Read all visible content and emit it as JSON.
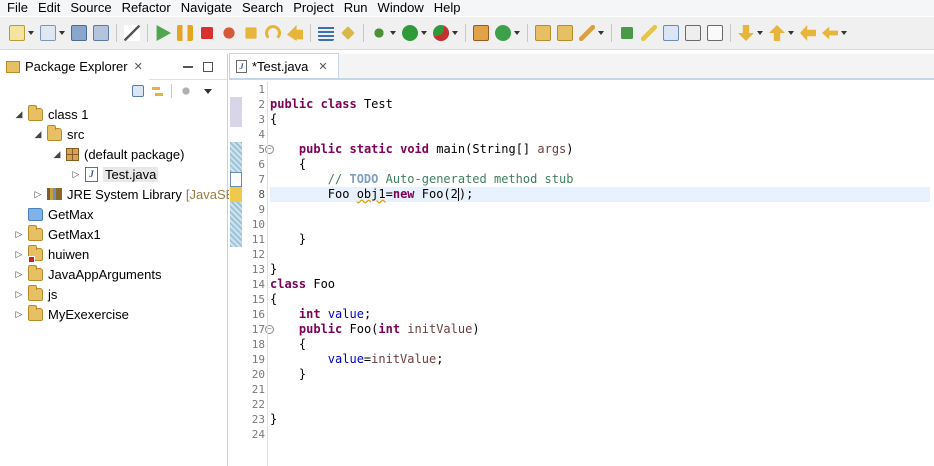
{
  "menu": [
    "File",
    "Edit",
    "Source",
    "Refactor",
    "Navigate",
    "Search",
    "Project",
    "Run",
    "Window",
    "Help"
  ],
  "package_explorer": {
    "title": "Package Explorer",
    "close": "✕",
    "tree": [
      {
        "label": "class 1",
        "depth": 0,
        "expanded": true,
        "icon": "project-folder-icon"
      },
      {
        "label": "src",
        "depth": 1,
        "expanded": true,
        "icon": "source-folder-icon"
      },
      {
        "label": "(default package)",
        "depth": 2,
        "expanded": true,
        "icon": "package-icon"
      },
      {
        "label": "Test.java",
        "depth": 3,
        "expanded": false,
        "icon": "java-file-icon",
        "selected": true
      },
      {
        "label": "JRE System Library",
        "suffix": "[JavaSE",
        "depth": 1,
        "expanded": false,
        "icon": "library-icon"
      },
      {
        "label": "GetMax",
        "depth": 0,
        "expanded": null,
        "icon": "blue-folder-icon"
      },
      {
        "label": "GetMax1",
        "depth": 0,
        "expanded": false,
        "icon": "project-folder-icon"
      },
      {
        "label": "huiwen",
        "depth": 0,
        "expanded": false,
        "icon": "project-folder-error-icon"
      },
      {
        "label": "JavaAppArguments",
        "depth": 0,
        "expanded": false,
        "icon": "project-folder-icon"
      },
      {
        "label": "js",
        "depth": 0,
        "expanded": false,
        "icon": "project-folder-icon"
      },
      {
        "label": "MyExexercise",
        "depth": 0,
        "expanded": false,
        "icon": "project-folder-icon"
      }
    ]
  },
  "editor": {
    "tab_title": "*Test.java",
    "close": "✕",
    "line_numbers": [
      "1",
      "2",
      "3",
      "4",
      "5",
      "6",
      "7",
      "8",
      "9",
      "10",
      "11",
      "12",
      "13",
      "14",
      "15",
      "16",
      "17",
      "18",
      "19",
      "20",
      "21",
      "22",
      "23",
      "24"
    ],
    "code": {
      "l2a": "public",
      "l2b": "class",
      "l2c": " Test",
      "l3": "{",
      "l5a": "public",
      "l5b": "static",
      "l5c": "void",
      "l5d": " main(String[] ",
      "l5e": "args",
      "l5f": ")",
      "l6": "{",
      "l7a": "// ",
      "l7b": "TODO",
      "l7c": " Auto-generated method stub",
      "l8a": "Foo ",
      "l8b": "obj1",
      "l8c": "=",
      "l8d": "new",
      "l8e": " Foo(",
      "l8f": "2",
      "l8g": ");",
      "l11": "}",
      "l13": "}",
      "l14a": "class",
      "l14b": " Foo",
      "l15": "{",
      "l16a": "int",
      "l16b": "value",
      "l16c": ";",
      "l17a": "public",
      "l17b": " Foo(",
      "l17c": "int",
      "l17d": " initValue",
      "l17e": ")",
      "l18": "{",
      "l19a": "value",
      "l19b": "=",
      "l19c": "initValue",
      "l19d": ";",
      "l20": "}",
      "l23": "}"
    }
  }
}
